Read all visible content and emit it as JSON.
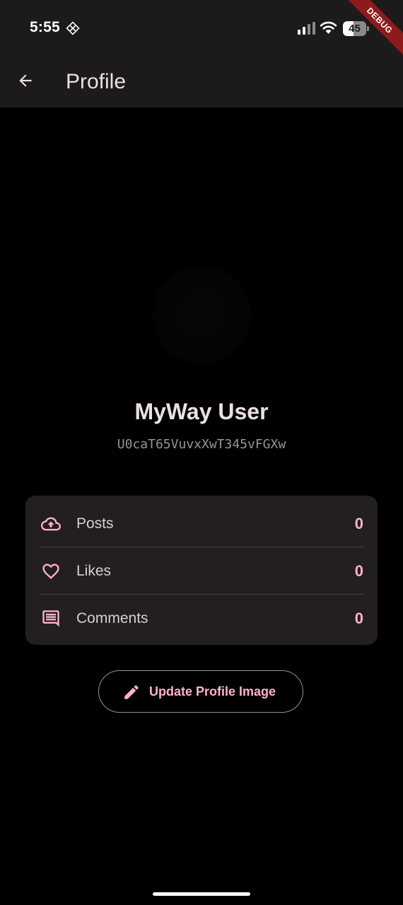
{
  "status_bar": {
    "time": "5:55",
    "app_icon": "grid-diamond-icon",
    "signal_icon": "cellular-signal-icon",
    "wifi_icon": "wifi-icon",
    "battery_level": "45",
    "battery_fraction": 0.45
  },
  "debug_banner": "DEBUG",
  "app_bar": {
    "back_icon": "arrow-back-icon",
    "title": "Profile"
  },
  "profile": {
    "name": "MyWay User",
    "user_id": "U0caT65VuvxXwT345vFGXw"
  },
  "stats": [
    {
      "icon": "cloud-upload-icon",
      "label": "Posts",
      "value": "0"
    },
    {
      "icon": "heart-icon",
      "label": "Likes",
      "value": "0"
    },
    {
      "icon": "comment-icon",
      "label": "Comments",
      "value": "0"
    }
  ],
  "actions": {
    "update_profile_image": {
      "icon": "pencil-icon",
      "label": "Update Profile Image"
    }
  },
  "colors": {
    "background": "#000000",
    "surface": "#1d1a1c",
    "card": "#231e20",
    "accent": "#ffb3c6",
    "text_primary": "#ebe0e2",
    "text_secondary": "#9a9294",
    "debug_ribbon": "#8e1b1b"
  }
}
